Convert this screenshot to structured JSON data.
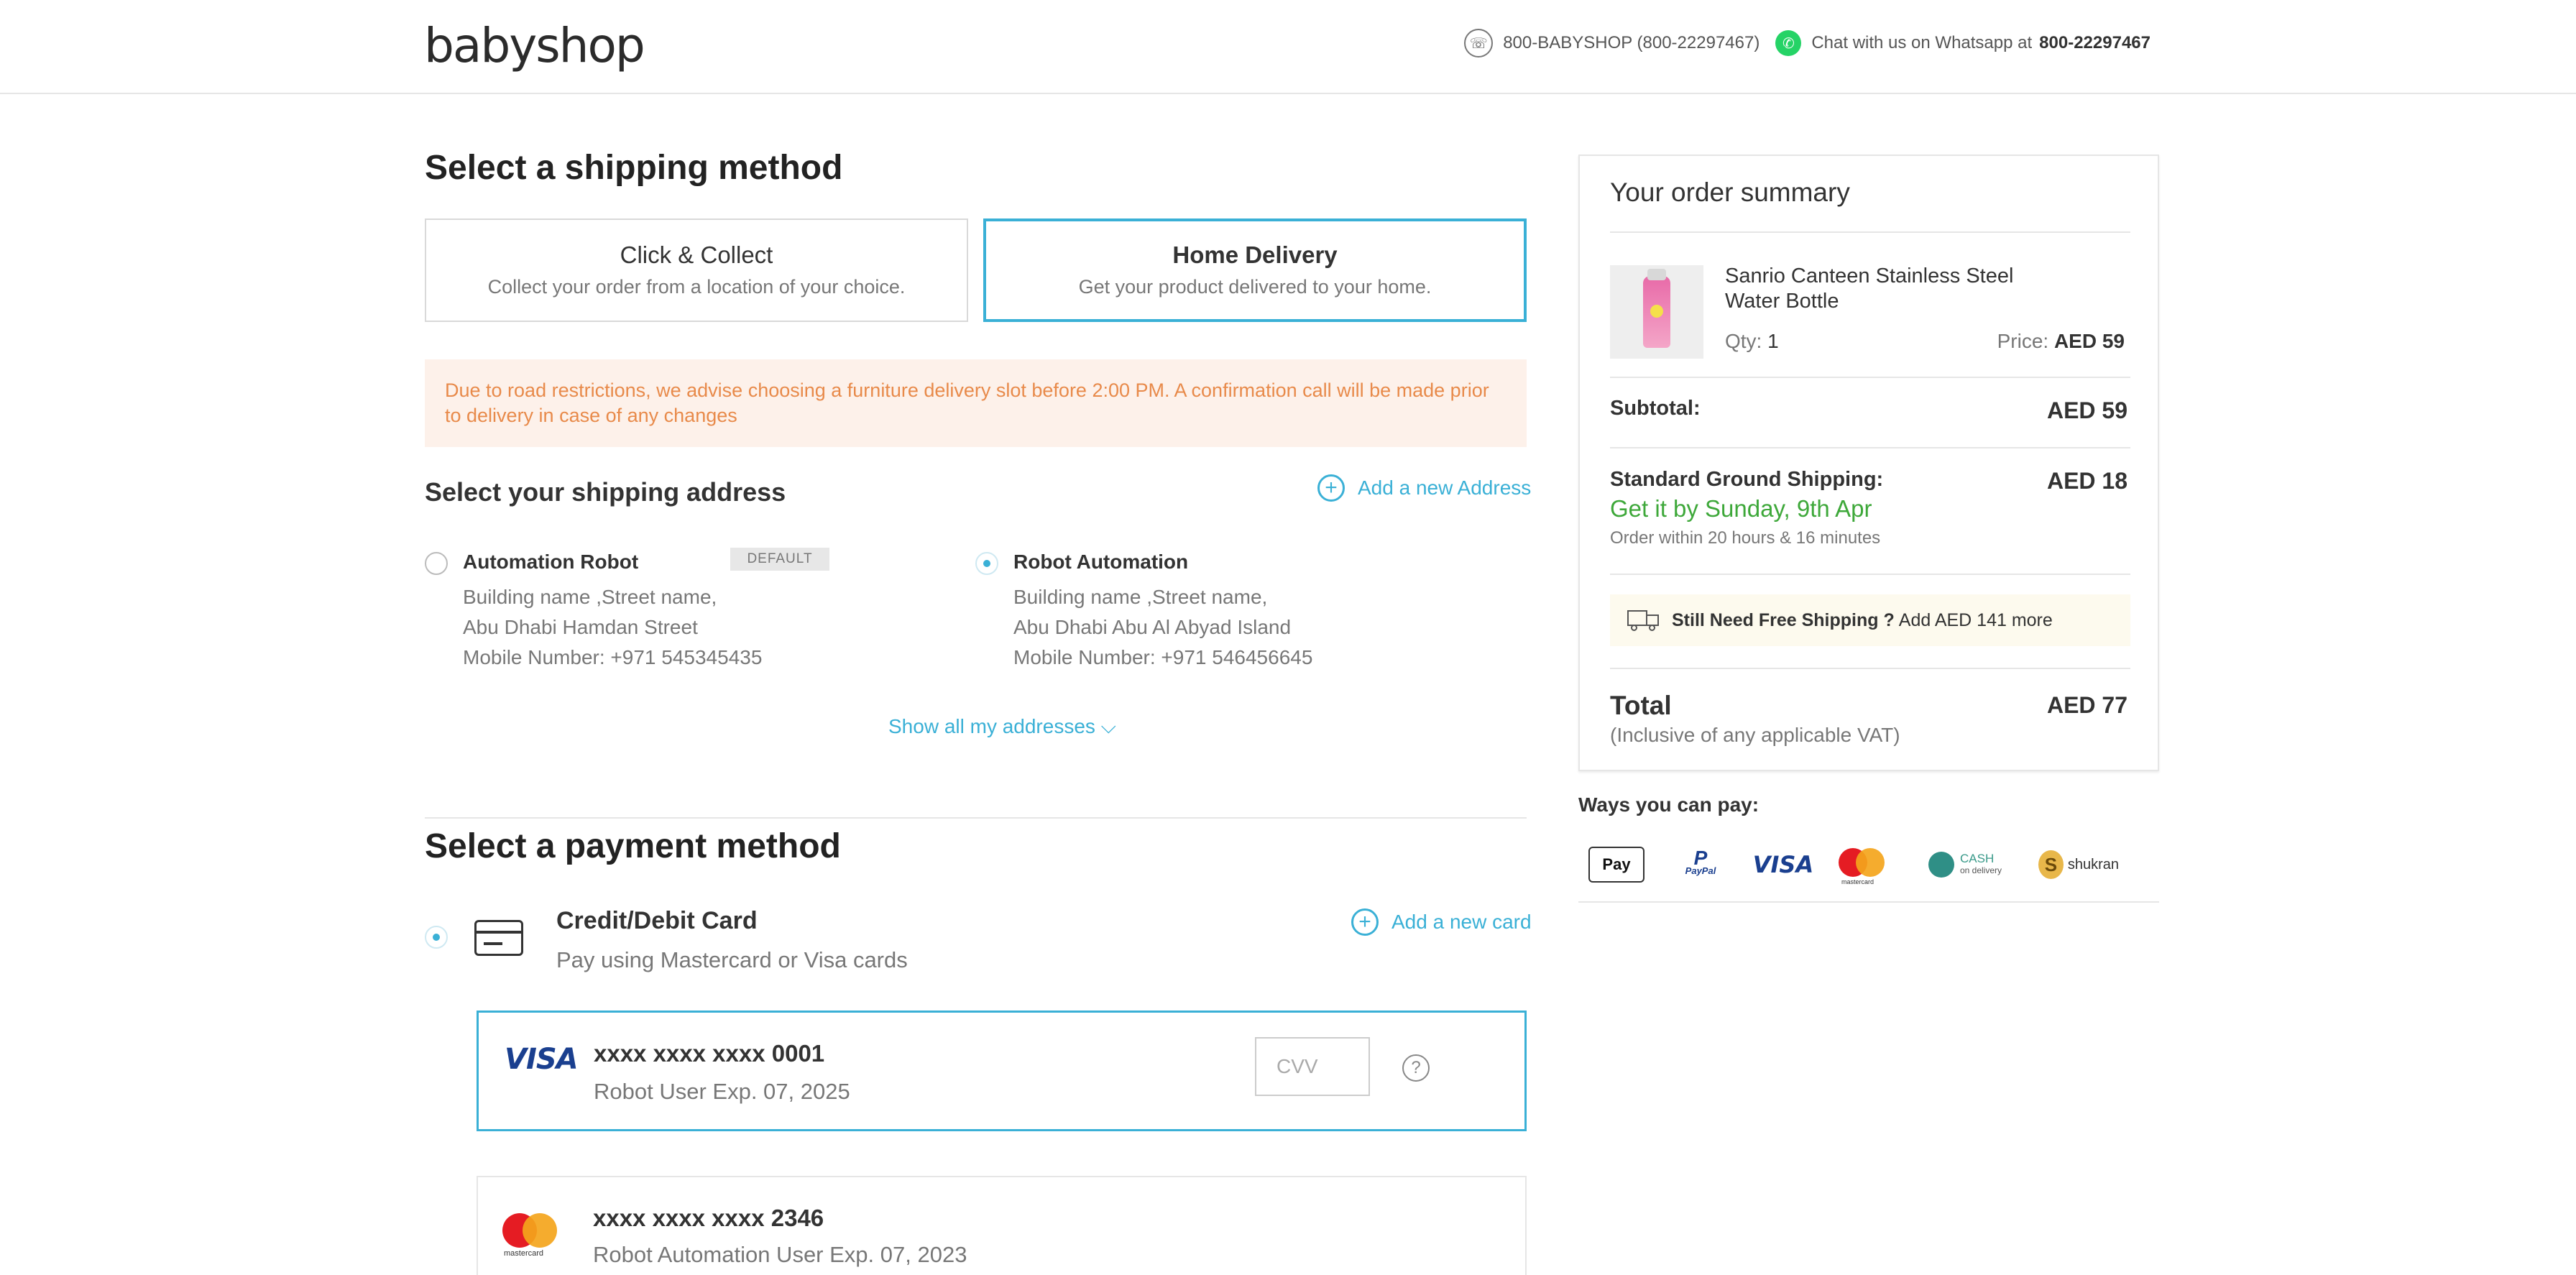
{
  "header": {
    "logo_text": "babyshop",
    "phone": "800-BABYSHOP (800-22297467)",
    "whatsapp_text": "Chat with us on Whatsapp at",
    "whatsapp_number": "800-22297467",
    "icons": [
      "phone-icon",
      "whatsapp-icon"
    ]
  },
  "shipping": {
    "title": "Select a shipping method",
    "options": [
      {
        "title": "Click & Collect",
        "subtitle": "Collect your order from a location of your choice.",
        "selected": false
      },
      {
        "title": "Home Delivery",
        "subtitle": "Get your product delivered to your home.",
        "selected": true
      }
    ],
    "notice": "Due to road restrictions, we advise choosing a furniture delivery slot before 2:00 PM. A confirmation call will be made prior to delivery in case of any changes"
  },
  "address": {
    "title": "Select your shipping address",
    "add_label": "Add a new Address",
    "default_badge": "DEFAULT",
    "items": [
      {
        "name": "Automation Robot",
        "line1": "Building name ,Street name,",
        "line2": "Abu Dhabi Hamdan Street",
        "mobile": "Mobile Number: +971 545345435",
        "selected": false,
        "is_default": true
      },
      {
        "name": "Robot Automation",
        "line1": "Building name ,Street name,",
        "line2": "Abu Dhabi Abu Al Abyad Island",
        "mobile": "Mobile Number: +971 546456645",
        "selected": true,
        "is_default": false
      }
    ],
    "show_all": "Show all my addresses ⌵"
  },
  "payment": {
    "title": "Select a payment method",
    "method_title": "Credit/Debit Card",
    "method_subtitle": "Pay using Mastercard or Visa cards",
    "add_card_label": "Add a new card",
    "cards": [
      {
        "brand": "VISA",
        "number": "xxxx xxxx xxxx 0001",
        "holder": "Robot User Exp. 07, 2025",
        "cvv_placeholder": "CVV",
        "help": "?"
      },
      {
        "brand": "mastercard",
        "number": "xxxx xxxx xxxx 2346",
        "holder": "Robot Automation User Exp. 07, 2023"
      }
    ]
  },
  "summary": {
    "title": "Your order summary",
    "product": {
      "name": "Sanrio Canteen Stainless Steel Water Bottle",
      "qty_label": "Qty:",
      "qty": "1",
      "price_label": "Price:",
      "price": "AED 59"
    },
    "subtotal_label": "Subtotal:",
    "subtotal": "AED 59",
    "shipping_label": "Standard Ground Shipping:",
    "shipping_value": "AED 18",
    "delivery_eta": "Get it by Sunday, 9th Apr",
    "order_within": "Order within 20 hours & 16 minutes",
    "free_ship_bold": "Still Need Free Shipping ?",
    "free_ship_rest": "Add AED 141 more",
    "total_label": "Total",
    "total_sub": "(Inclusive of any applicable VAT)",
    "total": "AED 77"
  },
  "ways_to_pay": {
    "title": "Ways you can pay:",
    "methods": {
      "apple": " Pay",
      "paypal_top": "P",
      "paypal": "PayPal",
      "visa": "VISA",
      "mastercard": "mastercard",
      "cod_top": "CASH",
      "cod_bottom": "on delivery",
      "shukran_mark": "S",
      "shukran": "shukran"
    }
  },
  "colors": {
    "accent": "#3ab0d6",
    "notice_text": "#e88a4a",
    "notice_bg": "#fdf1ea",
    "green": "#3ea83a"
  }
}
